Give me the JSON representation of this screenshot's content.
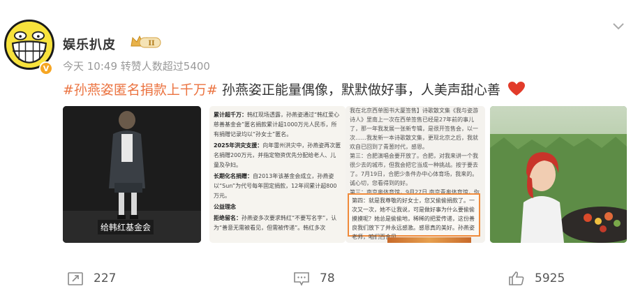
{
  "account": {
    "name": "娱乐扒皮",
    "level": "II",
    "verified": "V"
  },
  "meta": {
    "time": "今天 10:49",
    "likes_summary": "转赞人数超过5400"
  },
  "post": {
    "hashtag": "#孙燕姿匿名捐款上千万#",
    "text": " 孙燕姿正能量偶像，默默做好事，人美声甜心善"
  },
  "images": {
    "img1_caption": "给韩红基金会",
    "doc1": {
      "p1_head": "累计超千万：",
      "p1": "韩红现场透露，孙燕姿通过“韩红爱心慈善基金会”匿名捐款累计超1000万元人民币，所有捐赠记录均以“孙女士”匿名。",
      "p2_head": "2025年洪灾支援：",
      "p2": "向年雷州洪灾中，孙燕姿再次匿名捐赠200万元，并指定物资优先分配给老人、儿童及孕妇。",
      "p3_head": "长期化名捐赠：",
      "p3": "自2013年该基金会成立，孙燕姿以“Sun”为代号每年固定捐款，12年间累计超800万元。",
      "p4_head": "公益理念",
      "p5_head": "拒绝留名：",
      "p5": "孙燕姿多次要求韩红“不要写名字”，认为“善意无需被看见，但需被传递”。韩红多次"
    },
    "doc2": {
      "top": "我在北京西单图书大厦签售】诗歌散文集《我与姿游诗人》里南上一次在西单签售已经是27年前的事儿了，那一年我发展一张新专辑，是很开签售会，以一次……我发新一本诗歌散文集，更现北京之后，我就欢自已回到了青葱时代，感恩。",
      "mid": "第三：合肥演唱会要开放了。合肥，对我来讲一个我很少去的城市，但我会把它当成一种挑战。按于要去了。7月19日，合肥少条件办中心体育场，我来的。诚心切，您看得到的好。",
      "mid2": "第三：南京奥体育馆，9月27日 南京青奥体育馆，你来你会惊心的，我来惊心，因为有我啊。",
      "box": "第四：就是我尊敬的好女士，您又偷偷捐款了。一次又一次，她不让我说，可是做好事为什么要偷偷摸摸呢？她总是偷偷地，稀稀的把爱传递，这份善良我们放下了并永远感激。感恩真的美好。孙燕姿老师，咱们百合见。"
    }
  },
  "actions": {
    "repost_count": "227",
    "comment_count": "78",
    "like_count": "5925"
  },
  "colors": {
    "hashtag": "#eb7340",
    "text": "#333333",
    "meta": "#999999",
    "avatar_bg": "#f7e23c"
  }
}
